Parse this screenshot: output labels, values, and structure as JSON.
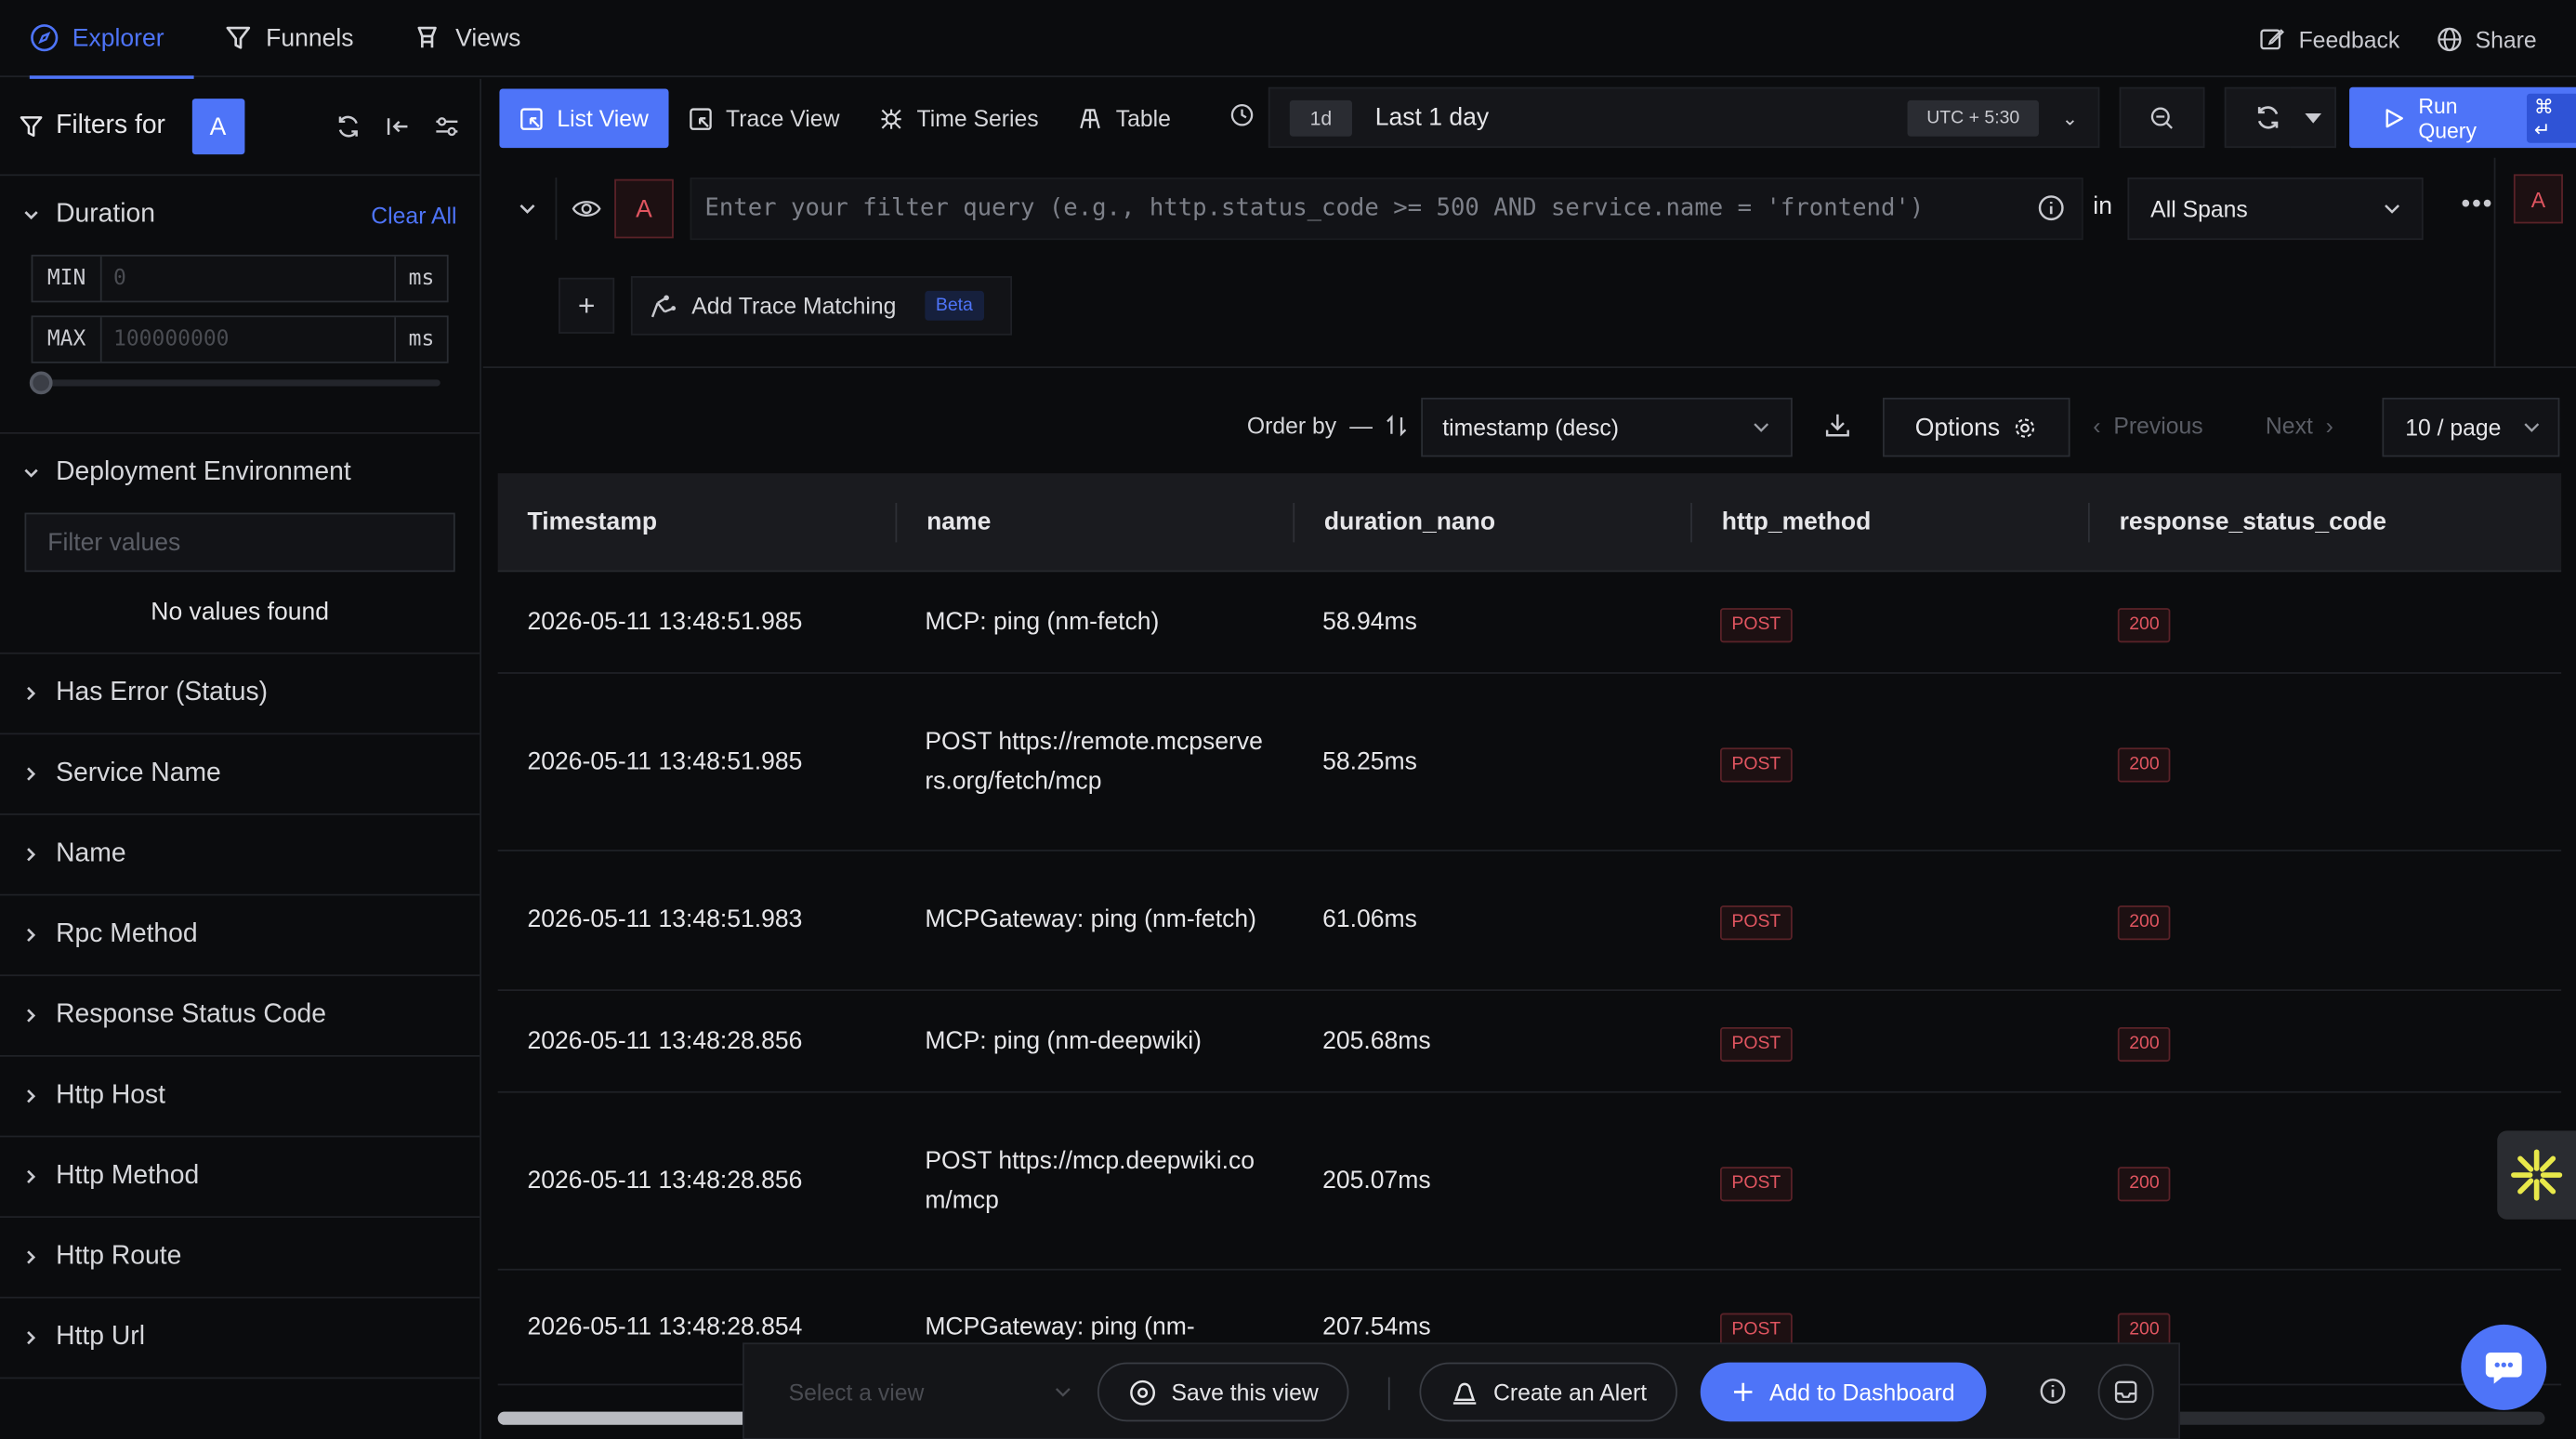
{
  "nav": {
    "tabs": [
      {
        "label": "Explorer",
        "icon": "compass-icon"
      },
      {
        "label": "Funnels",
        "icon": "funnel-icon"
      },
      {
        "label": "Views",
        "icon": "views-icon"
      }
    ],
    "feedback": "Feedback",
    "share": "Share"
  },
  "sidebar": {
    "title": "Filters for",
    "query_badge": "A",
    "duration": {
      "label": "Duration",
      "clear": "Clear All",
      "min_label": "MIN",
      "min_placeholder": "0",
      "max_label": "MAX",
      "max_placeholder": "100000000",
      "unit": "ms"
    },
    "deployment": {
      "label": "Deployment Environment",
      "filter_placeholder": "Filter values",
      "empty": "No values found"
    },
    "sections": [
      "Has Error (Status)",
      "Service Name",
      "Name",
      "Rpc Method",
      "Response Status Code",
      "Http Host",
      "Http Method",
      "Http Route",
      "Http Url"
    ]
  },
  "toolbar": {
    "views": [
      "List View",
      "Trace View",
      "Time Series",
      "Table"
    ],
    "time_short": "1d",
    "time_label": "Last 1 day",
    "timezone": "UTC + 5:30",
    "run": "Run Query",
    "run_kbd": "⌘ ↵"
  },
  "query": {
    "badge": "A",
    "placeholder": "Enter your filter query (e.g., http.status_code >= 500 AND service.name = 'frontend')",
    "in_label": "in",
    "source": "All Spans",
    "add_trace": "Add Trace Matching",
    "beta": "Beta",
    "right_badge": "A"
  },
  "list": {
    "order_by": "Order by",
    "order_value": "timestamp (desc)",
    "options": "Options",
    "previous": "Previous",
    "next": "Next",
    "per_page": "10 / page",
    "columns": [
      "Timestamp",
      "name",
      "duration_nano",
      "http_method",
      "response_status_code"
    ],
    "rows": [
      {
        "ts": "2026-05-11 13:48:51.985",
        "name": "MCP: ping (nm-fetch)",
        "dur": "58.94ms",
        "method": "POST",
        "status": "200"
      },
      {
        "ts": "2026-05-11 13:48:51.985",
        "name": "POST https://remote.mcpservers.org/fetch/mcp",
        "dur": "58.25ms",
        "method": "POST",
        "status": "200"
      },
      {
        "ts": "2026-05-11 13:48:51.983",
        "name": "MCPGateway: ping (nm-fetch)",
        "dur": "61.06ms",
        "method": "POST",
        "status": "200"
      },
      {
        "ts": "2026-05-11 13:48:28.856",
        "name": "MCP: ping (nm-deepwiki)",
        "dur": "205.68ms",
        "method": "POST",
        "status": "200"
      },
      {
        "ts": "2026-05-11 13:48:28.856",
        "name": "POST https://mcp.deepwiki.com/mcp",
        "dur": "205.07ms",
        "method": "POST",
        "status": "200"
      },
      {
        "ts": "2026-05-11 13:48:28.854",
        "name": "MCPGateway: ping (nm-",
        "dur": "207.54ms",
        "method": "POST",
        "status": "200"
      }
    ]
  },
  "bottom": {
    "select_view": "Select a view",
    "save": "Save this view",
    "alert": "Create an Alert",
    "dashboard": "Add to Dashboard"
  },
  "colors": {
    "accent": "#4e74f8",
    "danger": "#e05560",
    "background": "#0b0c0e"
  }
}
